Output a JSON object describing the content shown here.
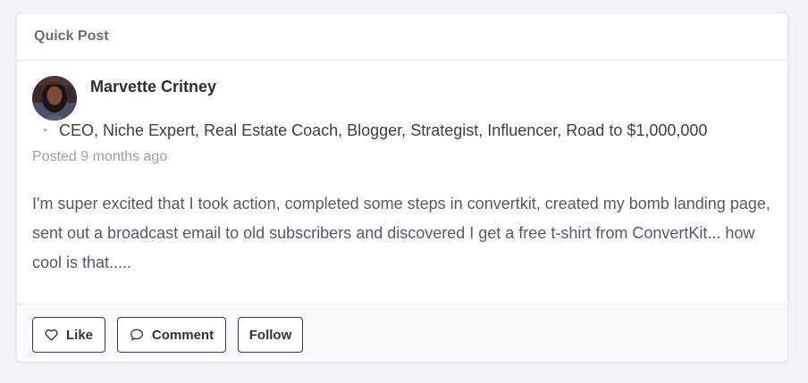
{
  "card": {
    "title": "Quick Post"
  },
  "post": {
    "author_name": "Marvette Critney",
    "author_tagline": "CEO, Niche Expert, Real Estate Coach, Blogger, Strategist, Influencer, Road to $1,000,000",
    "posted_time": "Posted 9 months ago",
    "text": "I'm super excited that I took action, completed some steps in convertkit, created my bomb landing page, sent out a broadcast email to old subscribers and discovered I get a free t-shirt from ConvertKit... how cool is that....."
  },
  "actions": {
    "like_label": "Like",
    "like_icon": "heart-icon",
    "comment_label": "Comment",
    "comment_icon": "speech-bubble-icon",
    "follow_label": "Follow"
  },
  "colors": {
    "button_border": "#2f3a4f",
    "footer_bg": "#fafafb"
  }
}
